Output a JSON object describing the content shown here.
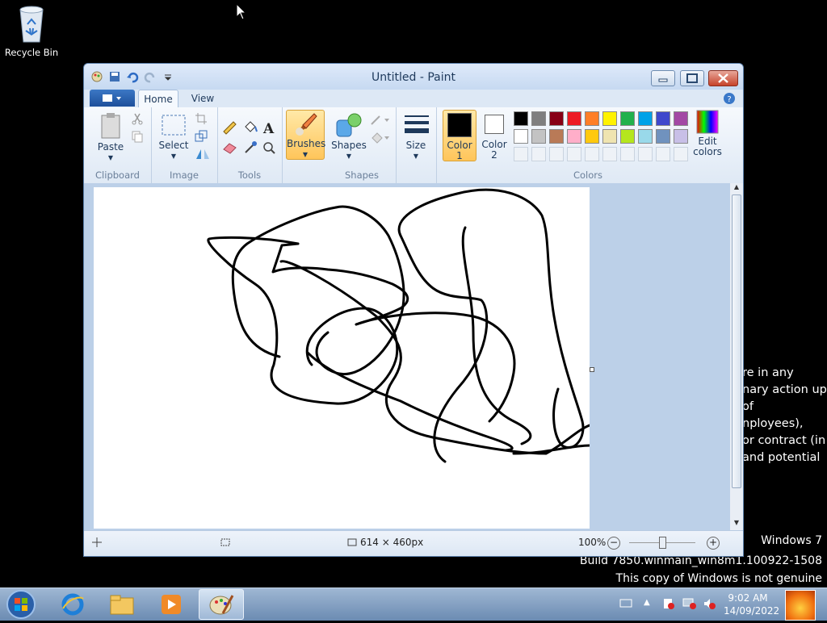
{
  "desktop": {
    "recycle_bin_label": "Recycle Bin",
    "background_text": [
      "re in any",
      "nary action up",
      "of",
      "nployees),",
      " or contract (in",
      "and potential"
    ],
    "watermark": {
      "line1": "Windows 7",
      "line2": "Build 7850.winmain_win8m1.100922-1508",
      "line3": "This copy of Windows is not genuine"
    }
  },
  "window": {
    "title": "Untitled - Paint",
    "tabs": [
      {
        "label": "Home",
        "active": true
      },
      {
        "label": "View",
        "active": false
      }
    ]
  },
  "ribbon": {
    "groups": {
      "clipboard": "Clipboard",
      "image": "Image",
      "tools": "Tools",
      "shapes": "Shapes",
      "colors": "Colors"
    },
    "paste_label": "Paste",
    "select_label": "Select",
    "brushes_label": "Brushes",
    "shapes_label": "Shapes",
    "size_label": "Size",
    "color1_label": "Color",
    "color1_num": "1",
    "color2_label": "Color",
    "color2_num": "2",
    "edit_colors_line1": "Edit",
    "edit_colors_line2": "colors",
    "color1_value": "#000000",
    "color2_value": "#ffffff",
    "palette_row1": [
      "#000000",
      "#7f7f7f",
      "#880015",
      "#ed1c24",
      "#ff7f27",
      "#fff200",
      "#22b14c",
      "#00a2e8",
      "#3f48cc",
      "#a349a4"
    ],
    "palette_row2": [
      "#ffffff",
      "#c3c3c3",
      "#b97a57",
      "#ffaec9",
      "#ffc90e",
      "#efe4b0",
      "#b5e61d",
      "#99d9ea",
      "#7092be",
      "#c8bfe7"
    ]
  },
  "statusbar": {
    "image_size": "614 × 460px",
    "zoom": "100%"
  },
  "taskbar": {
    "time": "9:02 AM",
    "date": "14/09/2022"
  }
}
